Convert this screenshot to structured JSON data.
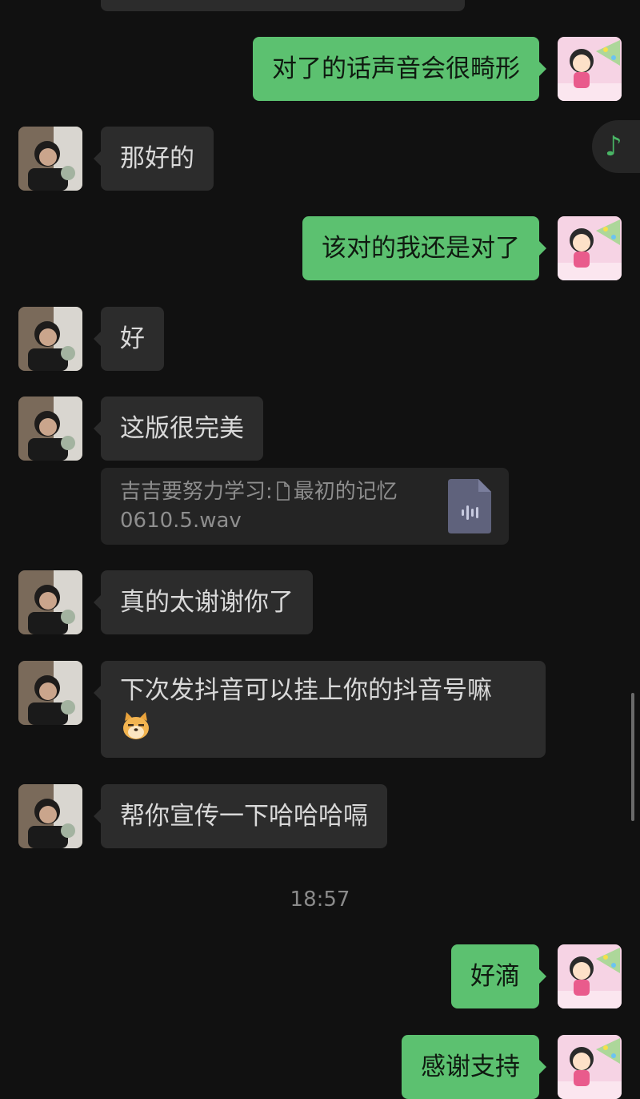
{
  "messages": [
    {
      "side": "out",
      "text": "对了的话声音会很畸形"
    },
    {
      "side": "in",
      "text": "那好的"
    },
    {
      "side": "out",
      "text": "该对的我还是对了"
    },
    {
      "side": "in",
      "text": "好"
    },
    {
      "side": "in",
      "text": "这版很完美"
    },
    {
      "side": "in",
      "text": "真的太谢谢你了"
    },
    {
      "side": "in",
      "text": "下次发抖音可以挂上你的抖音号嘛"
    },
    {
      "side": "in",
      "text": "帮你宣传一下哈哈哈嗝"
    },
    {
      "side": "out",
      "text": "好滴"
    },
    {
      "side": "out",
      "text": "感谢支持"
    }
  ],
  "quote": {
    "sender": "吉吉要努力学习:",
    "file_name_line1": "最初的记忆",
    "file_name_line2": "0610.5.wav",
    "file_icon": "audio-file-icon"
  },
  "timestamp": "18:57",
  "floating_player": {
    "icon": "music-note-icon",
    "glyph": "♪"
  },
  "colors": {
    "background": "#111111",
    "incoming_bubble": "#2c2c2c",
    "outgoing_bubble": "#5cc170",
    "timestamp": "#8a8a8a",
    "accent": "#49b565"
  }
}
